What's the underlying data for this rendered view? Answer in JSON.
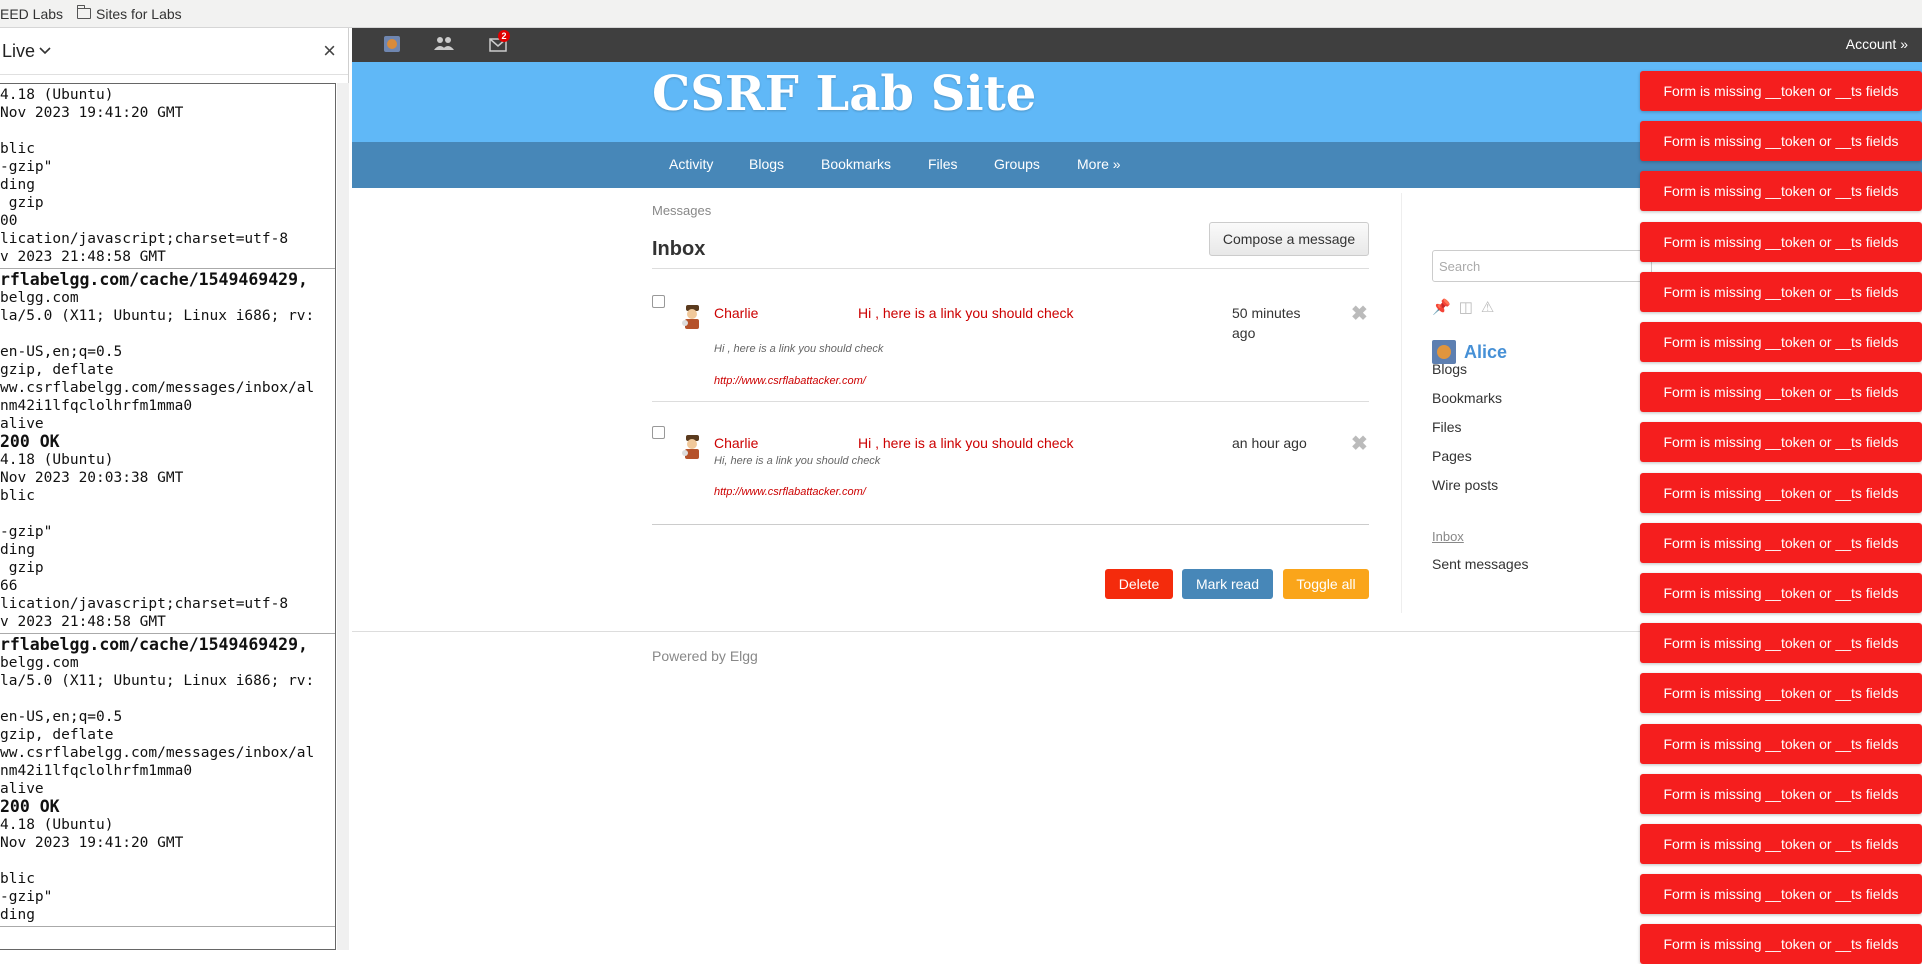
{
  "bookmarks": [
    {
      "label": "EED Labs",
      "icon": "folder-icon"
    },
    {
      "label": "Sites for Labs",
      "icon": "folder-icon"
    }
  ],
  "side_panel": {
    "mode_label": "Live",
    "close_label": "×",
    "log_blocks": [
      {
        "lines": [
          "4.18 (Ubuntu)",
          "Nov 2023 19:41:20 GMT",
          "",
          "blic",
          "-gzip\"",
          "ding",
          " gzip",
          "00",
          "lication/javascript;charset=utf-8",
          "v 2023 21:48:58 GMT"
        ]
      },
      {
        "lines": [
          "rflabelgg.com/cache/1549469429,",
          "belgg.com",
          "la/5.0 (X11; Ubuntu; Linux i686; rv:",
          "",
          "en-US,en;q=0.5",
          "gzip, deflate",
          "ww.csrflabelgg.com/messages/inbox/al",
          "nm42i1lfqclolhrfm1mma0",
          "alive",
          "200 OK",
          "4.18 (Ubuntu)",
          "Nov 2023 20:03:38 GMT",
          "blic",
          "",
          "-gzip\"",
          "ding",
          " gzip",
          "66",
          "lication/javascript;charset=utf-8",
          "v 2023 21:48:58 GMT"
        ]
      },
      {
        "lines": [
          "rflabelgg.com/cache/1549469429,",
          "belgg.com",
          "la/5.0 (X11; Ubuntu; Linux i686; rv:",
          "",
          "en-US,en;q=0.5",
          "gzip, deflate",
          "ww.csrflabelgg.com/messages/inbox/al",
          "nm42i1lfqclolhrfm1mma0",
          "alive",
          "200 OK",
          "4.18 (Ubuntu)",
          "Nov 2023 19:41:20 GMT",
          "",
          "blic",
          "-gzip\"",
          "ding"
        ]
      }
    ]
  },
  "top_bar": {
    "icons": [
      "site-logo-icon",
      "friends-icon",
      "mail-icon"
    ],
    "mail_badge": "2",
    "account_label": "Account »"
  },
  "site": {
    "title": "CSRF Lab Site",
    "nav": [
      "Activity",
      "Blogs",
      "Bookmarks",
      "Files",
      "Groups",
      "More »"
    ]
  },
  "messages": {
    "breadcrumb": "Messages",
    "title": "Inbox",
    "compose_label": "Compose a message",
    "items": [
      {
        "from": "Charlie",
        "subject": "Hi , here is a link you should check",
        "time": "50 minutes ago",
        "excerpt": "Hi , here is a link you should check",
        "link": "http://www.csrflabattacker.com/"
      },
      {
        "from": "Charlie",
        "subject": "Hi , here is a link you should check",
        "time": "an hour ago",
        "excerpt": "Hi, here is a link you should check",
        "link": "http://www.csrflabattacker.com/"
      }
    ],
    "delete_label": "Delete",
    "mark_read_label": "Mark read",
    "toggle_all_label": "Toggle all",
    "powered_by": "Powered by Elgg"
  },
  "sidebar": {
    "search_placeholder": "Search",
    "user_name": "Alice",
    "owner_links": [
      "Blogs",
      "Bookmarks",
      "Files",
      "Pages",
      "Wire posts"
    ],
    "inbox_label": "Inbox",
    "sent_label": "Sent messages"
  },
  "error_message": "Form is missing __token or __ts fields",
  "error_count": 18,
  "colors": {
    "header": "#60b8f7",
    "nav": "#4787b8",
    "error": "#f51e1e",
    "delete": "#f42b0c",
    "mark_read": "#4787b8",
    "toggle_all": "#faa51a"
  }
}
